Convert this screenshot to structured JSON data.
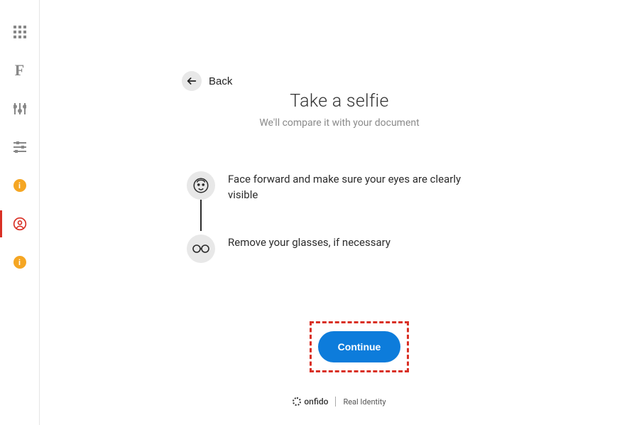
{
  "back": {
    "label": "Back"
  },
  "header": {
    "title": "Take a selfie",
    "subtitle": "We'll compare it with your document"
  },
  "instructions": [
    {
      "text": "Face forward and make sure your eyes are clearly visible"
    },
    {
      "text": "Remove your glasses, if necessary"
    }
  ],
  "cta": {
    "label": "Continue"
  },
  "footer": {
    "brand": "onfido",
    "tagline": "Real Identity"
  }
}
